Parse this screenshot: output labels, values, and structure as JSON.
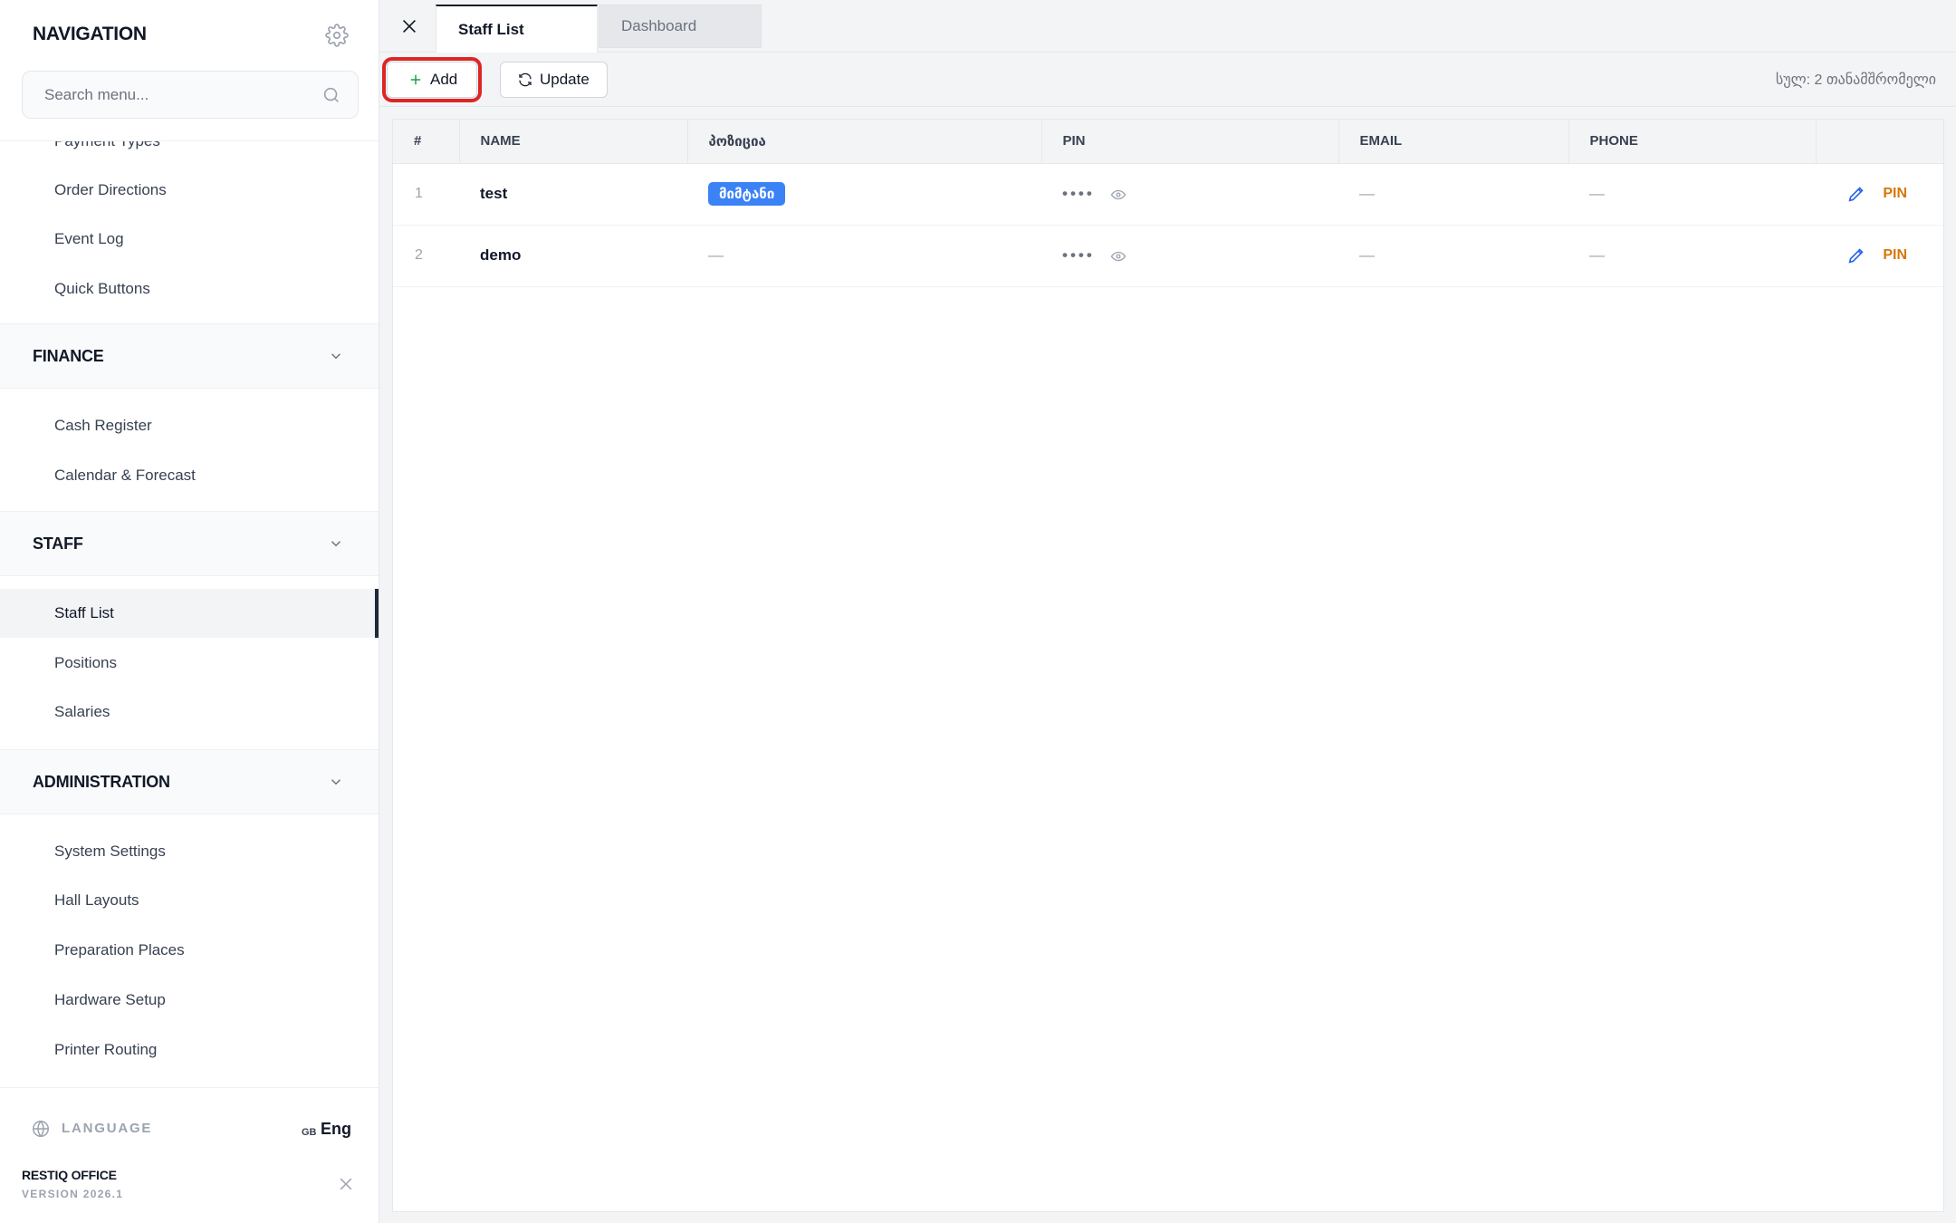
{
  "sidebar": {
    "title": "NAVIGATION",
    "search_placeholder": "Search menu...",
    "partial_item": "Payment Types",
    "groups": [
      {
        "items": [
          "Order Directions",
          "Event Log",
          "Quick Buttons"
        ]
      },
      {
        "section": "FINANCE",
        "items": [
          "Cash Register",
          "Calendar & Forecast"
        ]
      },
      {
        "section": "STAFF",
        "items": [
          "Staff List",
          "Positions",
          "Salaries"
        ],
        "active_item": "Staff List"
      },
      {
        "section": "ADMINISTRATION",
        "items": [
          "System Settings",
          "Hall Layouts",
          "Preparation Places",
          "Hardware Setup",
          "Printer Routing"
        ]
      }
    ],
    "footer": {
      "language_label": "LANGUAGE",
      "language_flag": "GB",
      "language_value": "Eng",
      "brand": "RESTIQ OFFICE",
      "version": "VERSION 2026.1"
    }
  },
  "tabs": [
    {
      "label": "Staff List",
      "active": true
    },
    {
      "label": "Dashboard",
      "active": false
    }
  ],
  "toolbar": {
    "add_label": "Add",
    "update_label": "Update",
    "count_text": "სულ: 2 თანამშრომელი"
  },
  "table": {
    "columns": [
      "#",
      "NAME",
      "პოზიცია",
      "PIN",
      "EMAIL",
      "PHONE",
      ""
    ],
    "rows": [
      {
        "num": "1",
        "name": "test",
        "position": "მიმტანი",
        "pin": "••••",
        "email": "—",
        "phone": "—",
        "action": "PIN"
      },
      {
        "num": "2",
        "name": "demo",
        "position": "—",
        "pin": "••••",
        "email": "—",
        "phone": "—",
        "action": "PIN"
      }
    ]
  },
  "colors": {
    "accent_blue": "#3b82f6",
    "pin_orange": "#d97706",
    "highlight_red": "#dc2626"
  }
}
